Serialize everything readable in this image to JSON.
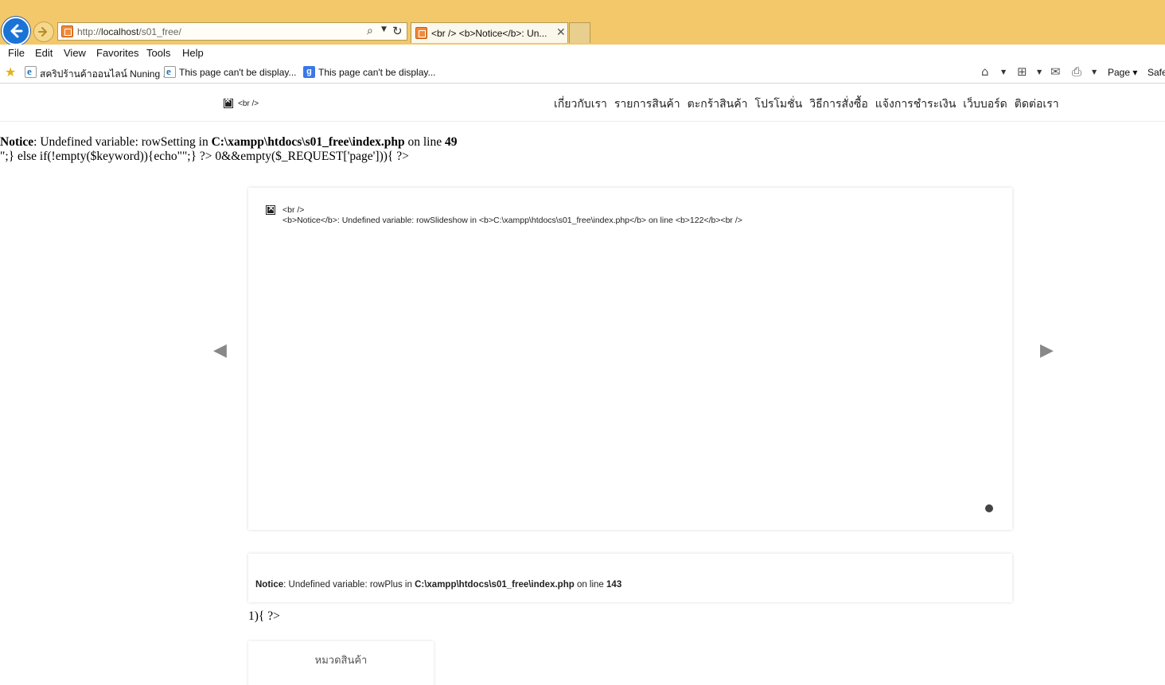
{
  "browser": {
    "url_prefix": "http://",
    "url_host": "localhost",
    "url_path": "/s01_free/",
    "tab_title": "<br /> <b>Notice</b>: Un...",
    "menu": [
      "File",
      "Edit",
      "View",
      "Favorites",
      "Tools",
      "Help"
    ],
    "favorites": [
      "สคริปร้านค้าออนไลน์  Nuning ...",
      "This page can't be display...",
      "This page can't be display..."
    ],
    "toolbar": {
      "page_label": "Page",
      "safety_label": "Safe"
    }
  },
  "site": {
    "logo_alt": "<br />",
    "nav": [
      "เกี่ยวกับเรา",
      "รายการสินค้า",
      "ตะกร้าสินค้า",
      "โปรโมชั่น",
      "วิธีการสั่งซื้อ",
      "แจ้งการชำระเงิน",
      "เว็บบอร์ด",
      "ติดต่อเรา"
    ]
  },
  "notice1": {
    "label": "Notice",
    "message": ": Undefined variable: rowSetting in ",
    "file": "C:\\xampp\\htdocs\\s01_free\\index.php",
    "on_line": " on line ",
    "line": "49",
    "stray": "\";} else if(!empty($keyword)){echo\"\";} ?> 0&&empty($_REQUEST['page'])){ ?>"
  },
  "slider": {
    "alt_line1": "<br />",
    "alt_line2": "<b>Notice</b>:  Undefined variable: rowSlideshow in <b>C:\\xampp\\htdocs\\s01_free\\index.php</b> on line <b>122</b><br />",
    "prev": "◀",
    "next": "▶"
  },
  "plus_notice": {
    "label": "Notice",
    "message": ": Undefined variable: rowPlus in ",
    "file": "C:\\xampp\\htdocs\\s01_free\\index.php",
    "on_line": " on line ",
    "line": "143"
  },
  "stray2": "1){ ?>",
  "category": {
    "title": "หมวดสินค้า"
  }
}
